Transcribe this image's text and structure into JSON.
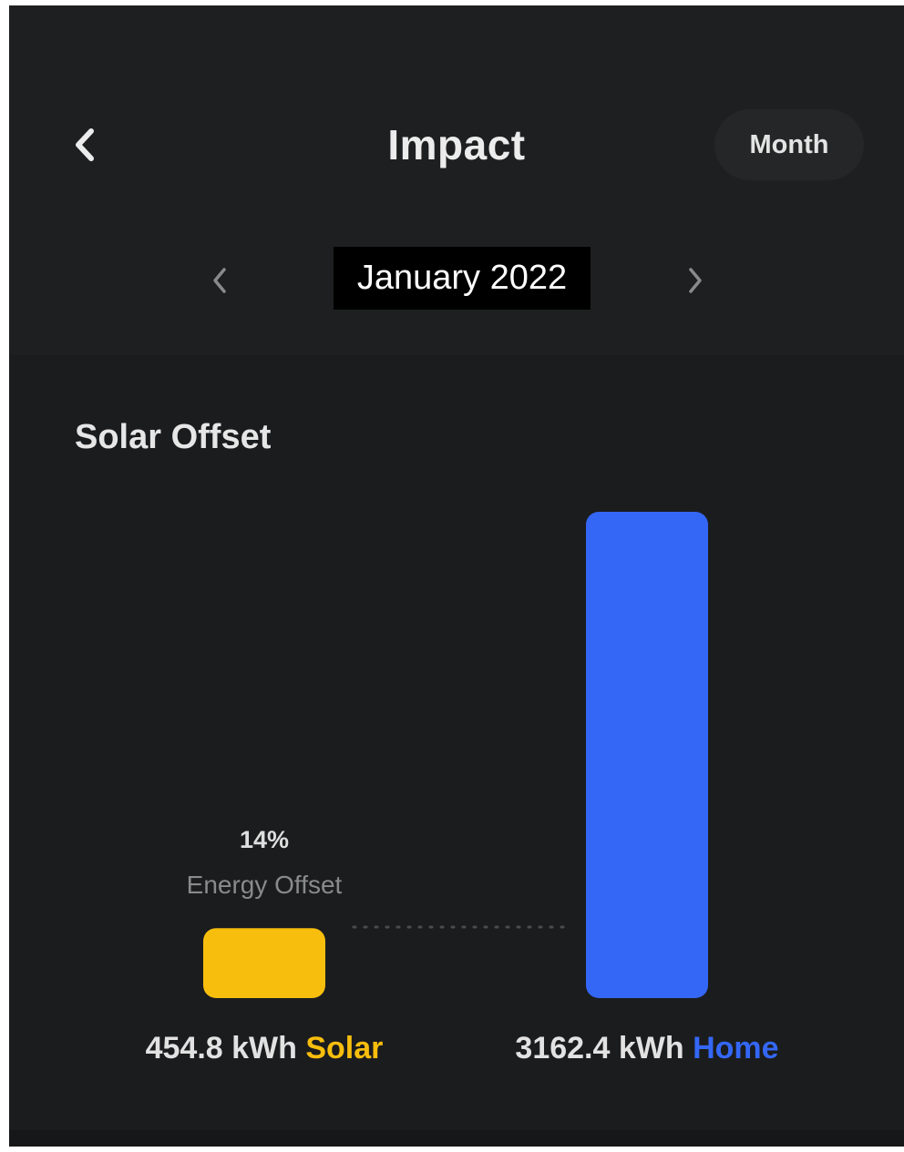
{
  "header": {
    "title": "Impact",
    "period_button": "Month",
    "back_icon": "chevron-left-icon",
    "prev_icon": "chevron-left-icon",
    "next_icon": "chevron-right-icon",
    "current_period": "January 2022"
  },
  "card": {
    "title": "Solar Offset",
    "offset_percent": "14%",
    "offset_label": "Energy Offset",
    "solar": {
      "value_text": "454.8 kWh",
      "label": "Solar"
    },
    "home": {
      "value_text": "3162.4 kWh",
      "label": "Home"
    }
  },
  "colors": {
    "background": "#1e1f20",
    "card": "#1b1c1e",
    "solar": "#f7be0d",
    "home": "#3467f5"
  },
  "chart_data": {
    "type": "bar",
    "title": "Solar Offset",
    "categories": [
      "Solar",
      "Home"
    ],
    "values": [
      454.8,
      3162.4
    ],
    "unit": "kWh",
    "colors": [
      "#f7be0d",
      "#3467f5"
    ],
    "annotation": "14% Energy Offset",
    "xlabel": "",
    "ylabel": "",
    "grid": false
  }
}
